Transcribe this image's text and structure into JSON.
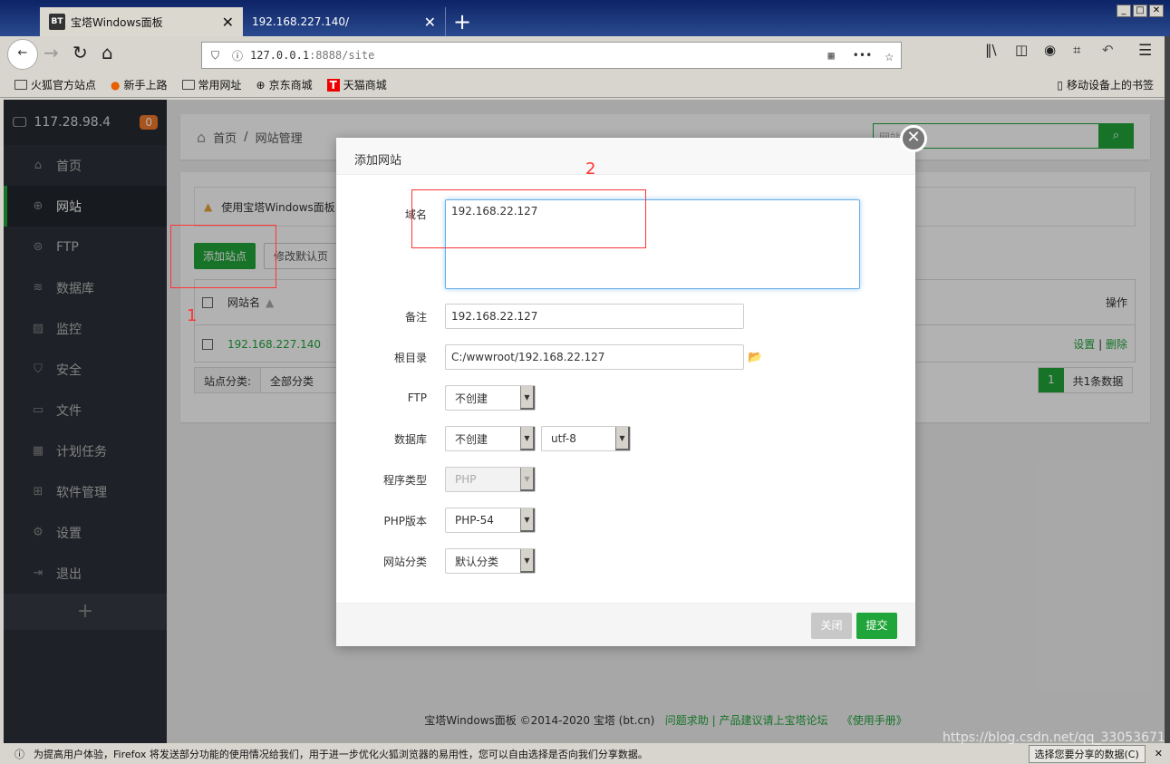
{
  "browser": {
    "tabs": [
      {
        "icon": "BT",
        "label": "宝塔Windows面板",
        "active": true
      },
      {
        "label": "192.168.227.140/",
        "active": false
      }
    ],
    "url_host": "127.0.0.1",
    "url_rest": ":8888/site",
    "bookmarks": [
      "火狐官方站点",
      "新手上路",
      "常用网址",
      "京东商城",
      "天猫商城"
    ],
    "mobile_bookmarks": "移动设备上的书签",
    "notification": "为提高用户体验，Firefox 将发送部分功能的使用情况给我们，用于进一步优化火狐浏览器的易用性，您可以自由选择是否向我们分享数据。",
    "notification_button": "选择您要分享的数据(C)",
    "watermark": "https://blog.csdn.net/qq_33053671"
  },
  "sidebar": {
    "server": "117.28.98.4",
    "badge": "0",
    "items": [
      {
        "label": "首页",
        "icon": "home-icon"
      },
      {
        "label": "网站",
        "icon": "globe-icon",
        "active": true
      },
      {
        "label": "FTP",
        "icon": "ftp-icon"
      },
      {
        "label": "数据库",
        "icon": "database-icon"
      },
      {
        "label": "监控",
        "icon": "monitor-icon"
      },
      {
        "label": "安全",
        "icon": "shield-icon"
      },
      {
        "label": "文件",
        "icon": "folder-icon"
      },
      {
        "label": "计划任务",
        "icon": "calendar-icon"
      },
      {
        "label": "软件管理",
        "icon": "grid-icon"
      },
      {
        "label": "设置",
        "icon": "gear-icon"
      },
      {
        "label": "退出",
        "icon": "logout-icon"
      }
    ],
    "add": "+"
  },
  "breadcrumb": {
    "home": "首页",
    "sep": "/",
    "current": "网站管理"
  },
  "search": {
    "placeholder": "网站"
  },
  "main": {
    "warning": "使用宝塔Windows面板",
    "add_site": "添加站点",
    "edit_default": "修改默认页",
    "table": {
      "col_name": "网站名",
      "col_ops": "操作",
      "rows": [
        {
          "name": "192.168.227.140",
          "ops_set": "设置",
          "ops_sep": "|",
          "ops_del": "删除"
        }
      ]
    },
    "category_label": "站点分类:",
    "category_value": "全部分类",
    "page": "1",
    "total": "共1条数据"
  },
  "footer": {
    "copyright": "宝塔Windows面板 ©2014-2020 宝塔 (bt.cn)",
    "help": "问题求助 | 产品建议请上宝塔论坛",
    "manual": "《使用手册》"
  },
  "modal": {
    "title": "添加网站",
    "domain_label": "域名",
    "domain_value": "192.168.22.127",
    "remark_label": "备注",
    "remark_value": "192.168.22.127",
    "root_label": "根目录",
    "root_value": "C:/wwwroot/192.168.22.127",
    "ftp_label": "FTP",
    "ftp_value": "不创建",
    "db_label": "数据库",
    "db_value": "不创建",
    "charset_value": "utf-8",
    "type_label": "程序类型",
    "type_value": "PHP",
    "php_label": "PHP版本",
    "php_value": "PHP-54",
    "cat_label": "网站分类",
    "cat_value": "默认分类",
    "close": "关闭",
    "submit": "提交"
  },
  "annotations": [
    "1",
    "2"
  ],
  "colors": {
    "accent": "#20a53a",
    "annotation": "#ff3333",
    "sidebar": "#2c3038"
  }
}
